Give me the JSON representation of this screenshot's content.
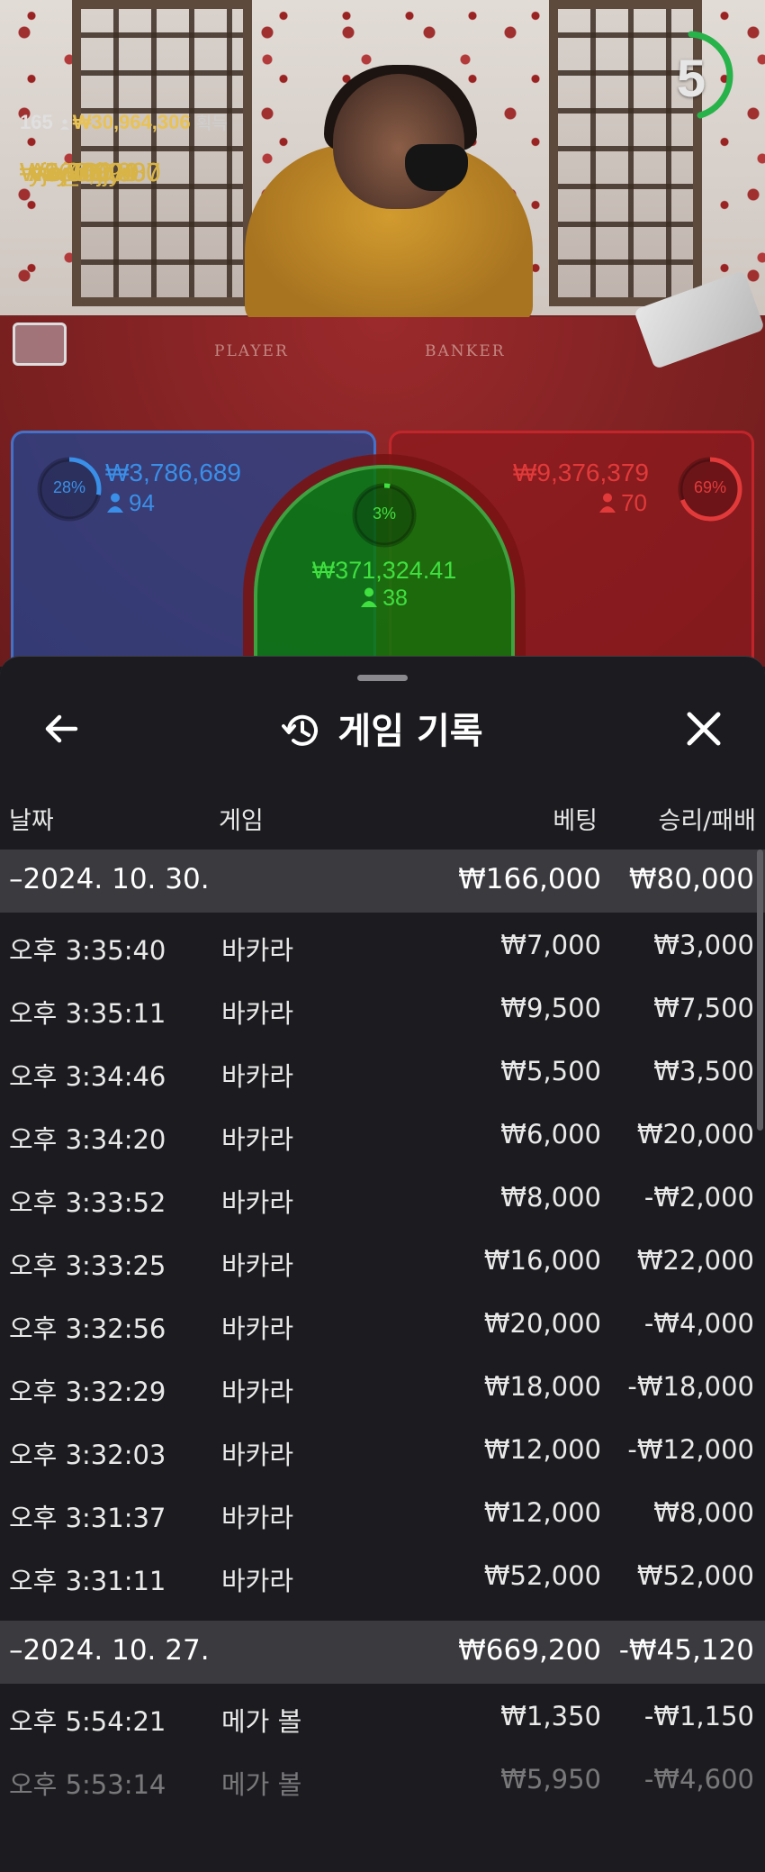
{
  "live": {
    "round_timer": "5",
    "table_words": {
      "player": "PLAYER",
      "banker": "BANKER"
    },
    "winners": {
      "count": "165",
      "total": "₩30,964,306",
      "total_label": "획득",
      "list": [
        {
          "amount": "₩5,040,000",
          "name": "mx_7994"
        },
        {
          "amount": "₩3,308,987",
          "name": "Aooo"
        },
        {
          "amount": "₩3,000,000",
          "name": "○○"
        },
        {
          "amount": "₩1,400,000",
          "name": "yjej76jjyu"
        },
        {
          "amount": "₩800,000",
          "name": "yuyu20"
        }
      ]
    },
    "bets": {
      "player": {
        "percent": "28%",
        "percent_value": 0.28,
        "amount": "₩3,786,689",
        "players": "94",
        "color": "#3a8fe8"
      },
      "tie": {
        "percent": "3%",
        "percent_value": 0.03,
        "amount": "₩371,324.41",
        "players": "38",
        "color": "#3fe03f"
      },
      "banker": {
        "percent": "69%",
        "percent_value": 0.69,
        "amount": "₩9,376,379",
        "players": "70",
        "color": "#e23a3a"
      }
    }
  },
  "sheet": {
    "title": "게임 기록",
    "icons": {
      "back": "arrow-left-icon",
      "history": "history-icon",
      "close": "close-icon"
    },
    "columns": {
      "date": "날짜",
      "game": "게임",
      "bet": "베팅",
      "result": "승리/패배"
    },
    "groups": [
      {
        "date": "–2024. 10. 30.",
        "bet_total": "₩166,000",
        "result_total": "₩80,000",
        "rows": [
          {
            "time": "오후 3:35:40",
            "game": "바카라",
            "bet": "₩7,000",
            "result": "₩3,000"
          },
          {
            "time": "오후 3:35:11",
            "game": "바카라",
            "bet": "₩9,500",
            "result": "₩7,500"
          },
          {
            "time": "오후 3:34:46",
            "game": "바카라",
            "bet": "₩5,500",
            "result": "₩3,500"
          },
          {
            "time": "오후 3:34:20",
            "game": "바카라",
            "bet": "₩6,000",
            "result": "₩20,000"
          },
          {
            "time": "오후 3:33:52",
            "game": "바카라",
            "bet": "₩8,000",
            "result": "-₩2,000"
          },
          {
            "time": "오후 3:33:25",
            "game": "바카라",
            "bet": "₩16,000",
            "result": "₩22,000"
          },
          {
            "time": "오후 3:32:56",
            "game": "바카라",
            "bet": "₩20,000",
            "result": "-₩4,000"
          },
          {
            "time": "오후 3:32:29",
            "game": "바카라",
            "bet": "₩18,000",
            "result": "-₩18,000"
          },
          {
            "time": "오후 3:32:03",
            "game": "바카라",
            "bet": "₩12,000",
            "result": "-₩12,000"
          },
          {
            "time": "오후 3:31:37",
            "game": "바카라",
            "bet": "₩12,000",
            "result": "₩8,000"
          },
          {
            "time": "오후 3:31:11",
            "game": "바카라",
            "bet": "₩52,000",
            "result": "₩52,000"
          }
        ]
      },
      {
        "date": "–2024. 10. 27.",
        "bet_total": "₩669,200",
        "result_total": "-₩45,120",
        "rows": [
          {
            "time": "오후 5:54:21",
            "game": "메가 볼",
            "bet": "₩1,350",
            "result": "-₩1,150"
          },
          {
            "time": "오후 5:53:14",
            "game": "메가 볼",
            "bet": "₩5,950",
            "result": "-₩4,600"
          }
        ]
      }
    ]
  }
}
